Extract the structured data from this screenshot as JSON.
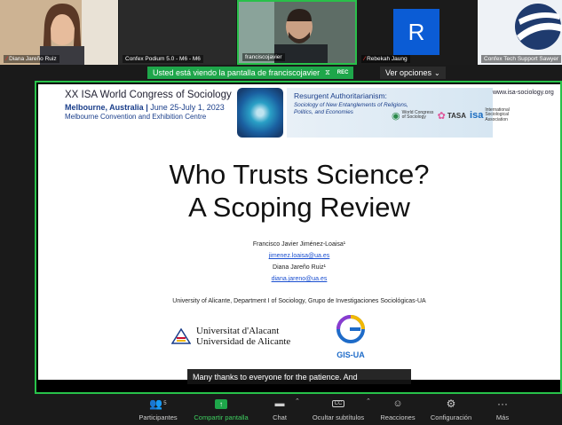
{
  "participants": [
    {
      "name": "Diana Jareño Ruiz",
      "muted": true
    },
    {
      "name": "Confex Podium 5.0 - M6 - M6",
      "muted": false
    },
    {
      "name": "franciscojavier",
      "muted": false
    },
    {
      "name": "Rebekah Jaung",
      "muted": true,
      "avatar_letter": "R",
      "avatar_color": "#0b5cd5"
    },
    {
      "name": "Confex Tech Support Sawyer",
      "muted": false
    }
  ],
  "share_banner": {
    "text": "Usted está viendo la pantalla de franciscojavier",
    "rec": "REC"
  },
  "view_options": {
    "label": "Ver opciones",
    "icon": "chevron-down-icon"
  },
  "slide": {
    "congress": "XX ISA World Congress of Sociology",
    "city": "Melbourne, Australia",
    "dates": "June 25-July 1, 2023",
    "venue": "Melbourne Convention and Exhibition Centre",
    "theme_title": "Resurgent Authoritarianism:",
    "theme_subtitle": "Sociology of New Entanglements of Religions, Politics, and Economies",
    "url": "www.isa-sociology.org",
    "sponsors": [
      "World Congress of Sociology",
      "TASA",
      "International Sociological Association"
    ],
    "title_line1": "Who Trusts Science?",
    "title_line2": "A Scoping Review",
    "author1": "Francisco Javier Jiménez-Loaisa¹",
    "email1": "jimenez.loaisa@ua.es",
    "author2": "Diana Jareño Ruiz¹",
    "email2": "diana.jareno@ua.es",
    "affiliation": "University of Alicante, Department I of Sociology, Grupo de Investigaciones Sociológicas-UA",
    "ua_line1": "Universitat d'Alacant",
    "ua_line2": "Universidad de Alicante",
    "gis_label": "GIS-UA"
  },
  "caption": "Many thanks to everyone for the patience. And",
  "toolbar": {
    "participants_label": "Participantes",
    "participants_count": "5",
    "share_label": "Compartir pantalla",
    "chat_label": "Chat",
    "subtitles_label": "Ocultar subtítulos",
    "reactions_label": "Reacciones",
    "settings_label": "Configuración",
    "more_label": "Más"
  },
  "colors": {
    "share_green": "#1ea64a",
    "share_border": "#28c24a",
    "muted_red": "#e0302b"
  }
}
